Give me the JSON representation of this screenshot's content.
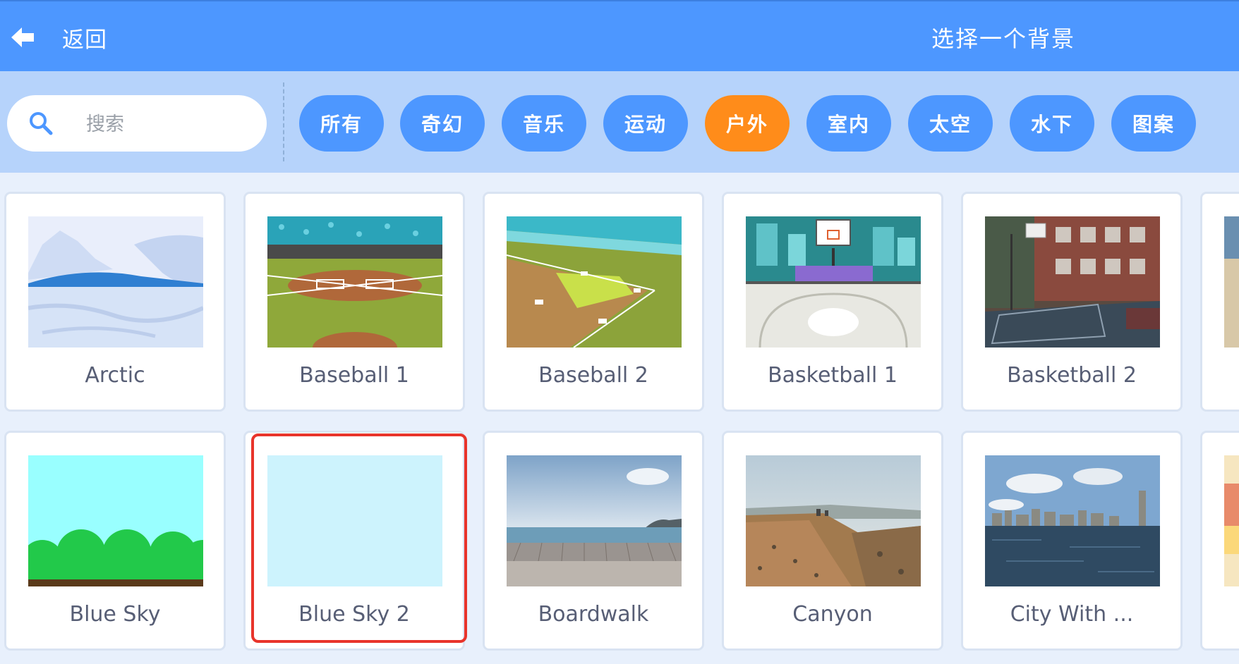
{
  "header": {
    "back_label": "返回",
    "title": "选择一个背景"
  },
  "search": {
    "placeholder": "搜索",
    "value": ""
  },
  "tags": [
    {
      "label": "所有",
      "active": false
    },
    {
      "label": "奇幻",
      "active": false
    },
    {
      "label": "音乐",
      "active": false
    },
    {
      "label": "运动",
      "active": false
    },
    {
      "label": "户外",
      "active": true
    },
    {
      "label": "室内",
      "active": false
    },
    {
      "label": "太空",
      "active": false
    },
    {
      "label": "水下",
      "active": false
    },
    {
      "label": "图案",
      "active": false
    }
  ],
  "backdrops": [
    {
      "name": "Arctic"
    },
    {
      "name": "Baseball 1"
    },
    {
      "name": "Baseball 2"
    },
    {
      "name": "Basketball 1"
    },
    {
      "name": "Basketball 2"
    },
    {
      "name": "Blue Sky"
    },
    {
      "name": "Blue Sky 2",
      "highlighted": true
    },
    {
      "name": "Boardwalk"
    },
    {
      "name": "Canyon"
    },
    {
      "name": "City With ..."
    }
  ],
  "colors": {
    "header_bg": "#4d97ff",
    "filter_bg": "#b6d3fb",
    "active_tag": "#ff8c1a",
    "highlight_frame": "#e8342b"
  },
  "icons": {
    "back": "arrow-left-icon",
    "search": "search-icon"
  }
}
